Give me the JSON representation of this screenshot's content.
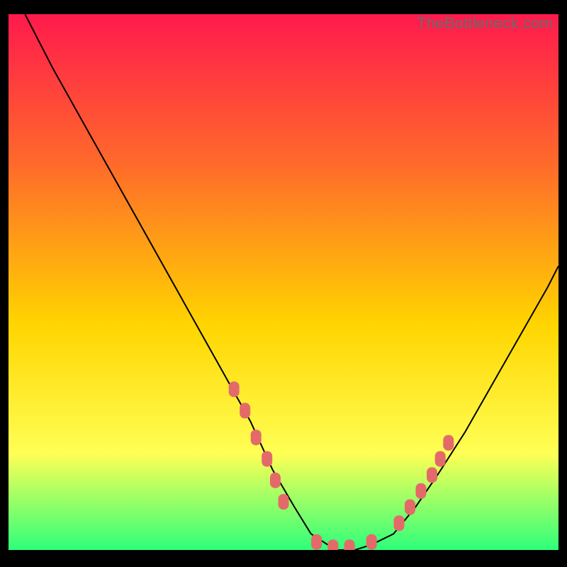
{
  "watermark": "TheBottleneck.com",
  "chart_data": {
    "type": "line",
    "title": "",
    "xlabel": "",
    "ylabel": "",
    "xlim": [
      0,
      100
    ],
    "ylim": [
      0,
      100
    ],
    "background_gradient": {
      "top": "#ff1a4d",
      "mid_upper": "#ff6a2a",
      "mid": "#ffd500",
      "mid_lower": "#ffff55",
      "bottom": "#2eff7a"
    },
    "series": [
      {
        "name": "bottleneck-curve",
        "color": "#000000",
        "x": [
          3,
          8,
          14,
          20,
          26,
          32,
          38,
          44,
          48,
          52,
          55,
          58,
          60,
          63,
          66,
          70,
          74,
          78,
          83,
          88,
          93,
          98,
          100
        ],
        "y": [
          100,
          90,
          79,
          68,
          57,
          46,
          35,
          24,
          15,
          8,
          3,
          1,
          0,
          0,
          1,
          3,
          8,
          14,
          22,
          31,
          40,
          49,
          53
        ]
      }
    ],
    "markers": {
      "name": "data-points",
      "color": "#e46a6a",
      "shape": "rounded-rect",
      "points": [
        {
          "x": 41,
          "y": 30
        },
        {
          "x": 43,
          "y": 26
        },
        {
          "x": 45,
          "y": 21
        },
        {
          "x": 47,
          "y": 17
        },
        {
          "x": 48.5,
          "y": 13
        },
        {
          "x": 50,
          "y": 9
        },
        {
          "x": 56,
          "y": 1.5
        },
        {
          "x": 59,
          "y": 0.5
        },
        {
          "x": 62,
          "y": 0.5
        },
        {
          "x": 66,
          "y": 1.5
        },
        {
          "x": 71,
          "y": 5
        },
        {
          "x": 73,
          "y": 8
        },
        {
          "x": 75,
          "y": 11
        },
        {
          "x": 77,
          "y": 14
        },
        {
          "x": 78.5,
          "y": 17
        },
        {
          "x": 80,
          "y": 20
        }
      ]
    }
  }
}
